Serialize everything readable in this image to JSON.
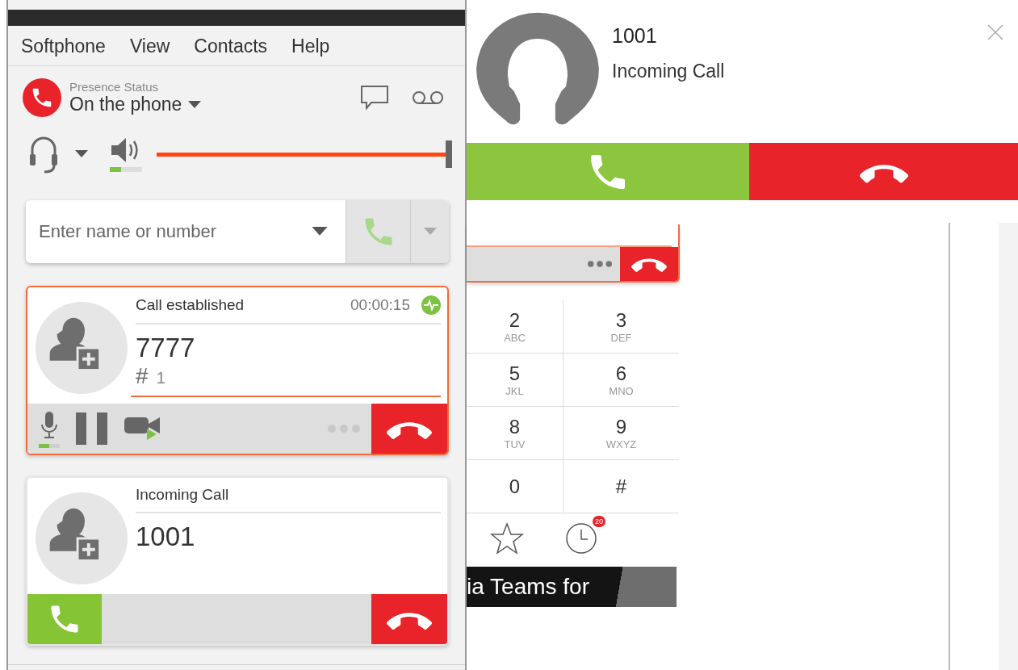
{
  "menu": [
    {
      "label": "Softphone"
    },
    {
      "label": "View"
    },
    {
      "label": "Contacts"
    },
    {
      "label": "Help"
    }
  ],
  "presence": {
    "label": "Presence Status",
    "value": "On the phone"
  },
  "audio": {
    "speaker_meter": {
      "level": 0.35
    },
    "volume": {
      "level": 1
    }
  },
  "dial": {
    "placeholder": "Enter name or number"
  },
  "calls": [
    {
      "kind": "established",
      "selected": true,
      "status": "Call established",
      "time": "00:00:15",
      "number": "7777",
      "sub_label": "#",
      "sub_value": "1",
      "mic": {
        "level": 0.5
      }
    },
    {
      "kind": "incoming",
      "selected": false,
      "status": "Incoming Call",
      "number": "1001"
    }
  ],
  "popup": {
    "name": "1001",
    "status": "Incoming Call"
  },
  "keypad": [
    {
      "digit": "2",
      "letters": "ABC"
    },
    {
      "digit": "3",
      "letters": "DEF"
    },
    {
      "digit": "5",
      "letters": "JKL"
    },
    {
      "digit": "6",
      "letters": "MNO"
    },
    {
      "digit": "8",
      "letters": "TUV"
    },
    {
      "digit": "9",
      "letters": "WXYZ"
    },
    {
      "digit": "0"
    },
    {
      "digit": "#"
    }
  ],
  "history_badge": "20",
  "banner": "ia Teams for"
}
